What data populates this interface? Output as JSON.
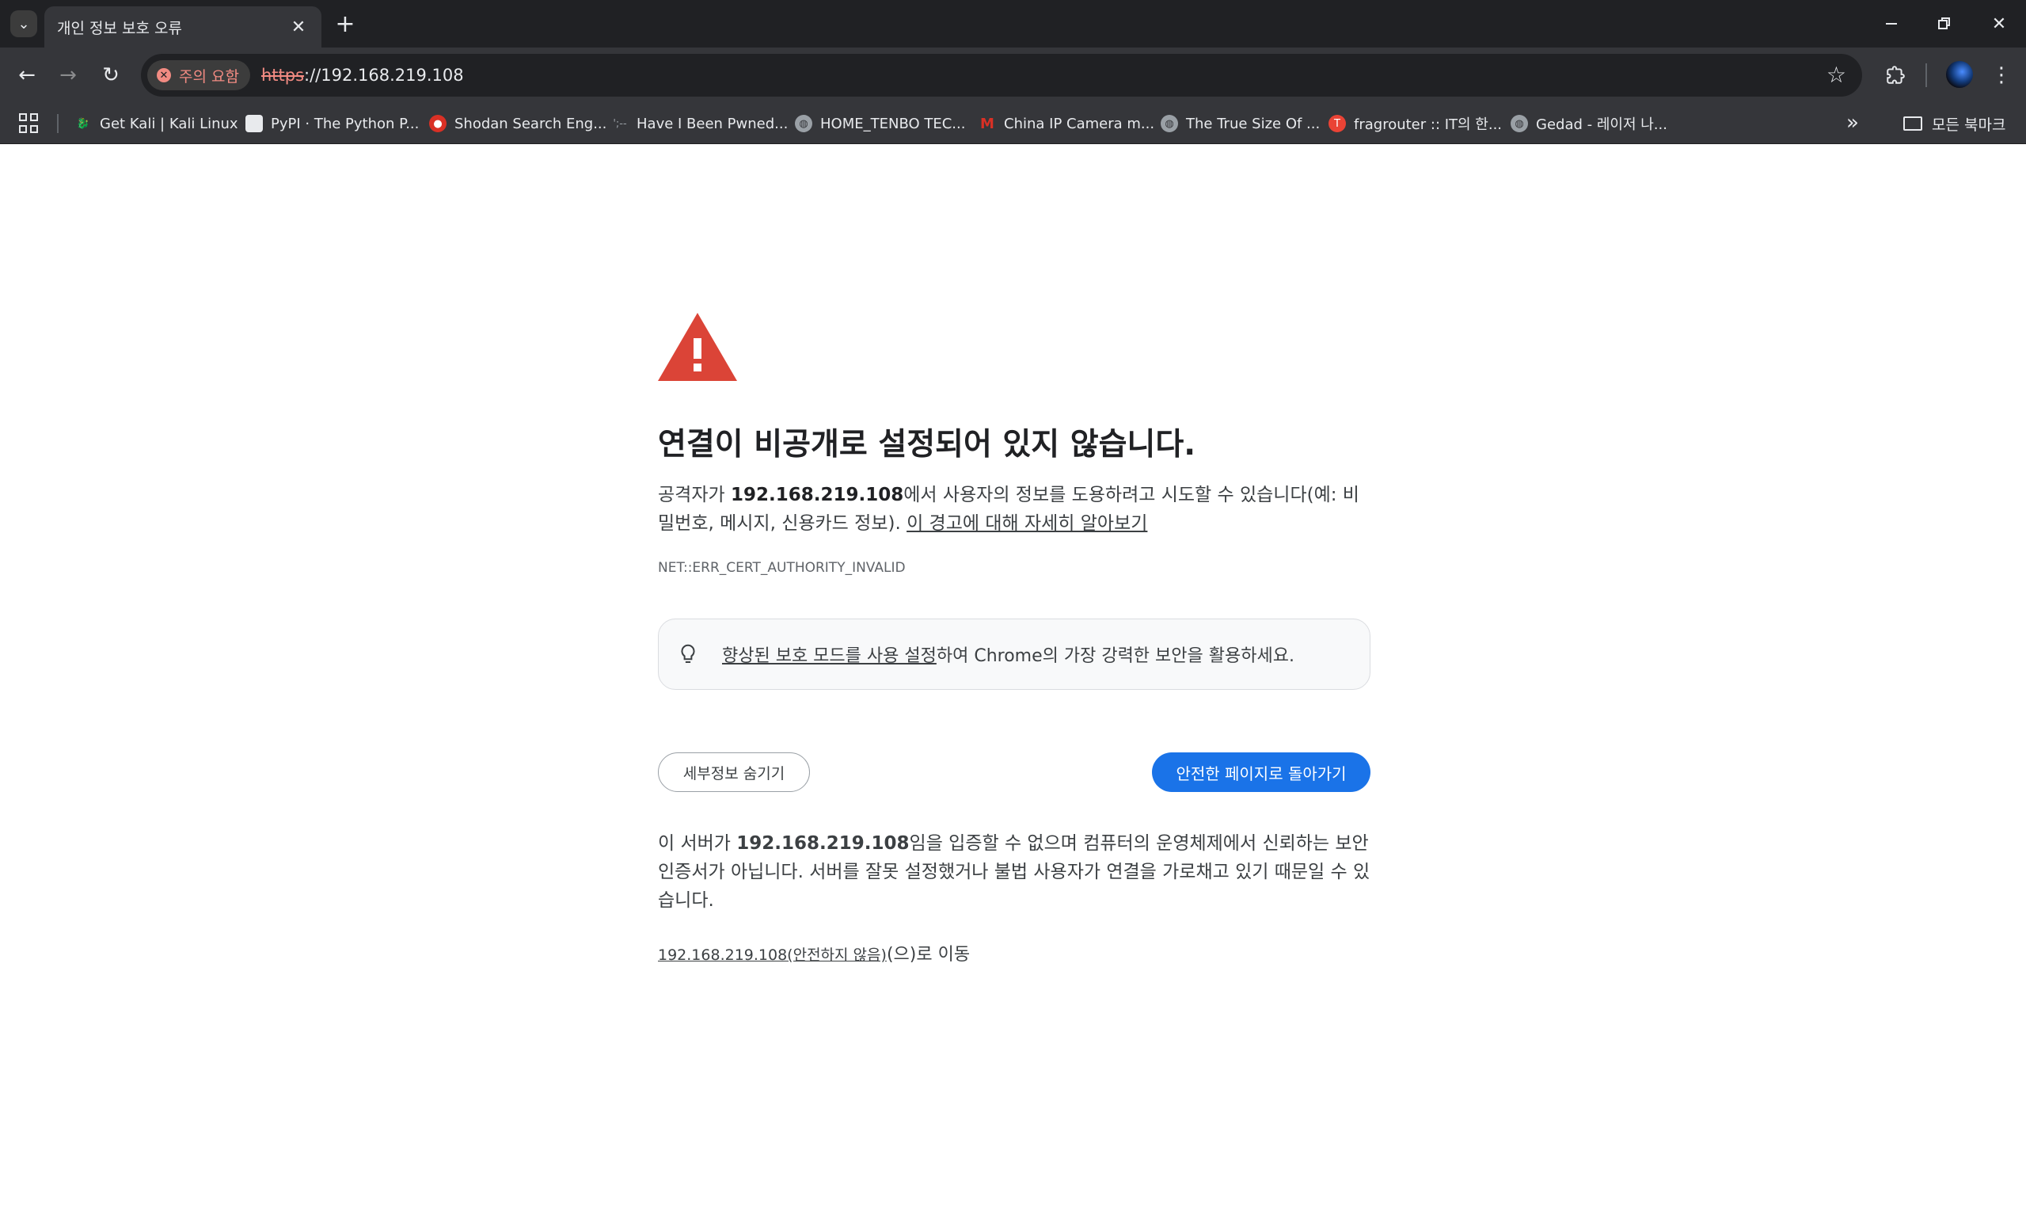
{
  "tab": {
    "title": "개인 정보 보호 오류"
  },
  "toolbar": {
    "security_chip": "주의 요함",
    "url_scheme": "https",
    "url_rest": "://192.168.219.108"
  },
  "bookmarks": {
    "items": [
      {
        "label": "Get Kali | Kali Linux",
        "icon_color": "#2b2b2b"
      },
      {
        "label": "PyPI · The Python P...",
        "icon_color": "#e8eaed"
      },
      {
        "label": "Shodan Search Eng...",
        "icon_color": "#d93025"
      },
      {
        "label": "Have I Been Pwned...",
        "icon_color": "#35363a"
      },
      {
        "label": "HOME_TENBO TEC...",
        "icon_color": "#9aa0a6"
      },
      {
        "label": "China IP Camera m...",
        "icon_color": "#d93025"
      },
      {
        "label": "The True Size Of ...",
        "icon_color": "#9aa0a6"
      },
      {
        "label": "fragrouter :: IT의 한...",
        "icon_color": "#ea4335"
      },
      {
        "label": "Gedad - 레이저 나...",
        "icon_color": "#9aa0a6"
      }
    ],
    "all_bookmarks": "모든 북마크"
  },
  "page": {
    "headline": "연결이 비공개로 설정되어 있지 않습니다.",
    "para_prefix": "공격자가 ",
    "host": "192.168.219.108",
    "para_suffix": "에서 사용자의 정보를 도용하려고 시도할 수 있습니다(예: 비밀번호, 메시지, 신용카드 정보). ",
    "learn_more": "이 경고에 대해 자세히 알아보기",
    "error_code": "NET::ERR_CERT_AUTHORITY_INVALID",
    "enhanced_link": "향상된 보호 모드를 사용 설정",
    "enhanced_rest": "하여 Chrome의 가장 강력한 보안을 활용하세요.",
    "details_button": "세부정보 숨기기",
    "back_button": "안전한 페이지로 돌아가기",
    "detail_prefix": "이 서버가 ",
    "detail_suffix": "임을 입증할 수 없으며 컴퓨터의 운영체제에서 신뢰하는 보안 인증서가 아닙니다. 서버를 잘못 설정했거나 불법 사용자가 연결을 가로채고 있기 때문일 수 있습니다.",
    "proceed_link": "192.168.219.108(안전하지 않음)",
    "proceed_tail": "(으)로 이동"
  }
}
